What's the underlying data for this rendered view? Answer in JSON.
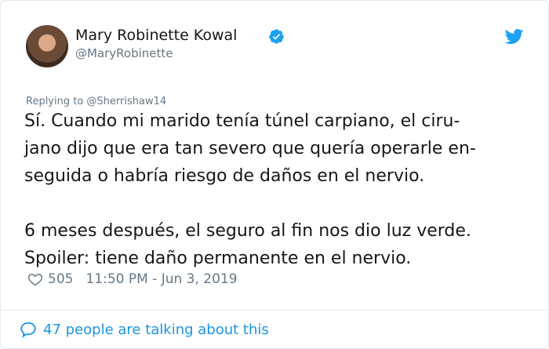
{
  "author": {
    "name": "Mary Robinette Kowal",
    "handle": "@MaryRobinette",
    "verified": true,
    "avatar_icon": "avatar-photo"
  },
  "tweet": {
    "reply_to": "Replying to @Sherrishaw14",
    "lines": [
      "Sí. Cuando mi marido tenía túnel carpiano, el ciru-",
      "jano dijo que era tan severo que quería operarle en-",
      "seguida o habría riesgo de daños en el nervio.",
      "6 meses después, el seguro al fin nos dio luz verde.",
      "Spoiler: tiene daño permanente en el nervio."
    ],
    "likes": "505",
    "timestamp": "11:50 PM - Jun 3, 2019"
  },
  "footer": {
    "talking": "47 people are talking about this"
  },
  "colors": {
    "accent": "#1da1f2",
    "link": "#1b95e0",
    "muted": "#657786",
    "text": "#14171a"
  }
}
